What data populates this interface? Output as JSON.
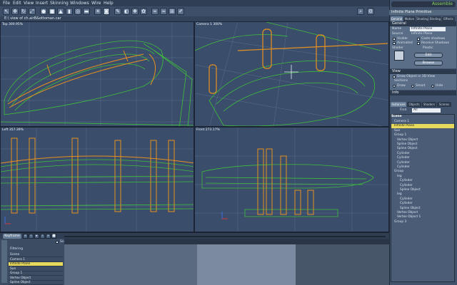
{
  "menu": {
    "items": [
      "File",
      "Edit",
      "View",
      "Insert",
      "Skinning",
      "Windows",
      "Wire",
      "Help"
    ],
    "mode_label": "Assemble"
  },
  "toolbar": {
    "icons": [
      "select-icon",
      "move-icon",
      "rotate-icon",
      "scale-icon",
      "sphere-icon",
      "cube-icon",
      "cone-icon",
      "cylinder-icon",
      "torus-icon",
      "plane-icon",
      "light-icon",
      "camera-icon",
      "sculpt-icon",
      "material-icon",
      "render-icon",
      "paint-icon",
      "link-icon",
      "deform-icon",
      "layout-icon",
      "brush-icon",
      "search-icon",
      "settings-icon"
    ]
  },
  "document": {
    "path": "E:\\ view of ch.airB&ottoman.car"
  },
  "viewports": [
    {
      "label": "Top 300.95%"
    },
    {
      "label": "Camera 1 300%"
    },
    {
      "label": "Left 357.39%"
    },
    {
      "label": "Front 273.17%"
    }
  ],
  "right_panel": {
    "header_title": "Infinite Plane Primitive",
    "tabs": [
      "General",
      "Motion",
      "Shading",
      "Binding",
      "Effects"
    ],
    "general": {
      "section_label": "General",
      "name_label": "Name",
      "name_value": "Infinite Plane",
      "source_label": "Source",
      "source_value": "Infinite Plane",
      "visible_label": "Visible",
      "animated_label": "Animated",
      "casts_shadows_label": "Casts shadows",
      "receive_shadows_label": "Receive Shadows",
      "shader_label": "Shader",
      "shader_value": "Plastic",
      "edit_button": "Edit",
      "browse_button": "Browse"
    },
    "view": {
      "section_label": "View",
      "draw_label": "Draw Object in 3D View",
      "sections_label": "Sections",
      "opt_draw": "Draw",
      "opt_smart": "Smart",
      "opt_hide": "Hide"
    },
    "info_section_label": "Info",
    "browser_tabs": [
      "Instances",
      "Objects",
      "Shaders",
      "Scenes"
    ],
    "find_label": "Find",
    "find_value": "All"
  },
  "scene_tree": {
    "title": "Scene",
    "rows": [
      {
        "label": "Camera 1",
        "indent": 1,
        "selected": false
      },
      {
        "label": "Infinite Plane",
        "indent": 1,
        "selected": true
      },
      {
        "label": "Sun",
        "indent": 1,
        "selected": false
      },
      {
        "label": "Group 1",
        "indent": 1,
        "selected": false
      },
      {
        "label": "Vertex Object",
        "indent": 2,
        "selected": false
      },
      {
        "label": "Spline Object",
        "indent": 2,
        "selected": false
      },
      {
        "label": "Spline Object",
        "indent": 2,
        "selected": false
      },
      {
        "label": "Cylinder",
        "indent": 2,
        "selected": false
      },
      {
        "label": "Cylinder",
        "indent": 2,
        "selected": false
      },
      {
        "label": "Cylinder",
        "indent": 2,
        "selected": false
      },
      {
        "label": "Cylinder",
        "indent": 2,
        "selected": false
      },
      {
        "label": "Group",
        "indent": 1,
        "selected": false
      },
      {
        "label": "leg",
        "indent": 2,
        "selected": false
      },
      {
        "label": "Cylinder",
        "indent": 3,
        "selected": false
      },
      {
        "label": "Cylinder",
        "indent": 3,
        "selected": false
      },
      {
        "label": "Spline Object",
        "indent": 3,
        "selected": false
      },
      {
        "label": "leg",
        "indent": 2,
        "selected": false
      },
      {
        "label": "Cylinder",
        "indent": 3,
        "selected": false
      },
      {
        "label": "Cylinder",
        "indent": 3,
        "selected": false
      },
      {
        "label": "Spline Object",
        "indent": 3,
        "selected": false
      },
      {
        "label": "Vertex Object",
        "indent": 2,
        "selected": false
      },
      {
        "label": "Vertex Object 1",
        "indent": 2,
        "selected": false
      },
      {
        "label": "Group 3",
        "indent": 1,
        "selected": false
      }
    ]
  },
  "timeline": {
    "mode_label": "Keyframe",
    "snap_label": "Snap",
    "filter_label": "Filtering",
    "rows": [
      {
        "label": "Scene",
        "selected": false
      },
      {
        "label": "Camera 1",
        "selected": false
      },
      {
        "label": "Infinite Plane",
        "selected": true
      },
      {
        "label": "Sun",
        "selected": false
      },
      {
        "label": "Group 1",
        "selected": false
      },
      {
        "label": "Vertex Object",
        "selected": false
      },
      {
        "label": "Spline Object",
        "selected": false
      }
    ]
  },
  "colors": {
    "viewport_bg": "#3a4e6b",
    "wire_green": "#3fbf3a",
    "wire_orange": "#e8901f",
    "selection_yellow": "#e7d95c"
  }
}
